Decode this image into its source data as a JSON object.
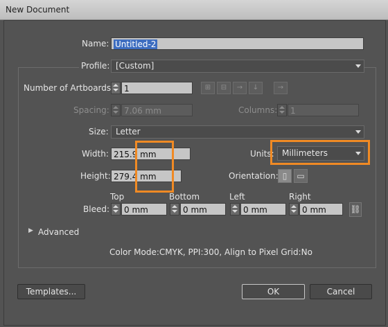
{
  "window": {
    "title": "New Document"
  },
  "name": {
    "label": "Name:",
    "value": "Untitled-2"
  },
  "profile": {
    "label": "Profile:",
    "value": "[Custom]"
  },
  "artboards": {
    "label": "Number of Artboards:",
    "value": "1",
    "arrange_icons": [
      "grid-by-row-icon",
      "grid-by-column-icon",
      "arrange-by-row-icon",
      "arrange-by-column-icon",
      "change-layout-icon"
    ]
  },
  "spacing": {
    "label": "Spacing:",
    "value": "7.06 mm"
  },
  "columns": {
    "label": "Columns:",
    "value": "1"
  },
  "size": {
    "label": "Size:",
    "value": "Letter"
  },
  "width": {
    "label": "Width:",
    "value": "215.9 mm"
  },
  "height": {
    "label": "Height:",
    "value": "279.4 mm"
  },
  "units": {
    "label": "Units:",
    "value": "Millimeters"
  },
  "orientation": {
    "label": "Orientation:",
    "icons": [
      "portrait-icon",
      "landscape-icon"
    ]
  },
  "bleed": {
    "label": "Bleed:",
    "top": {
      "label": "Top",
      "value": "0 mm"
    },
    "bottom": {
      "label": "Bottom",
      "value": "0 mm"
    },
    "left": {
      "label": "Left",
      "value": "0 mm"
    },
    "right": {
      "label": "Right",
      "value": "0 mm"
    },
    "link_icon": "chain-link-icon"
  },
  "advanced": {
    "label": "Advanced"
  },
  "info": "Color Mode:CMYK, PPI:300, Align to Pixel Grid:No",
  "buttons": {
    "templates": "Templates...",
    "ok": "OK",
    "cancel": "Cancel"
  },
  "highlight_color": "#f08a24"
}
